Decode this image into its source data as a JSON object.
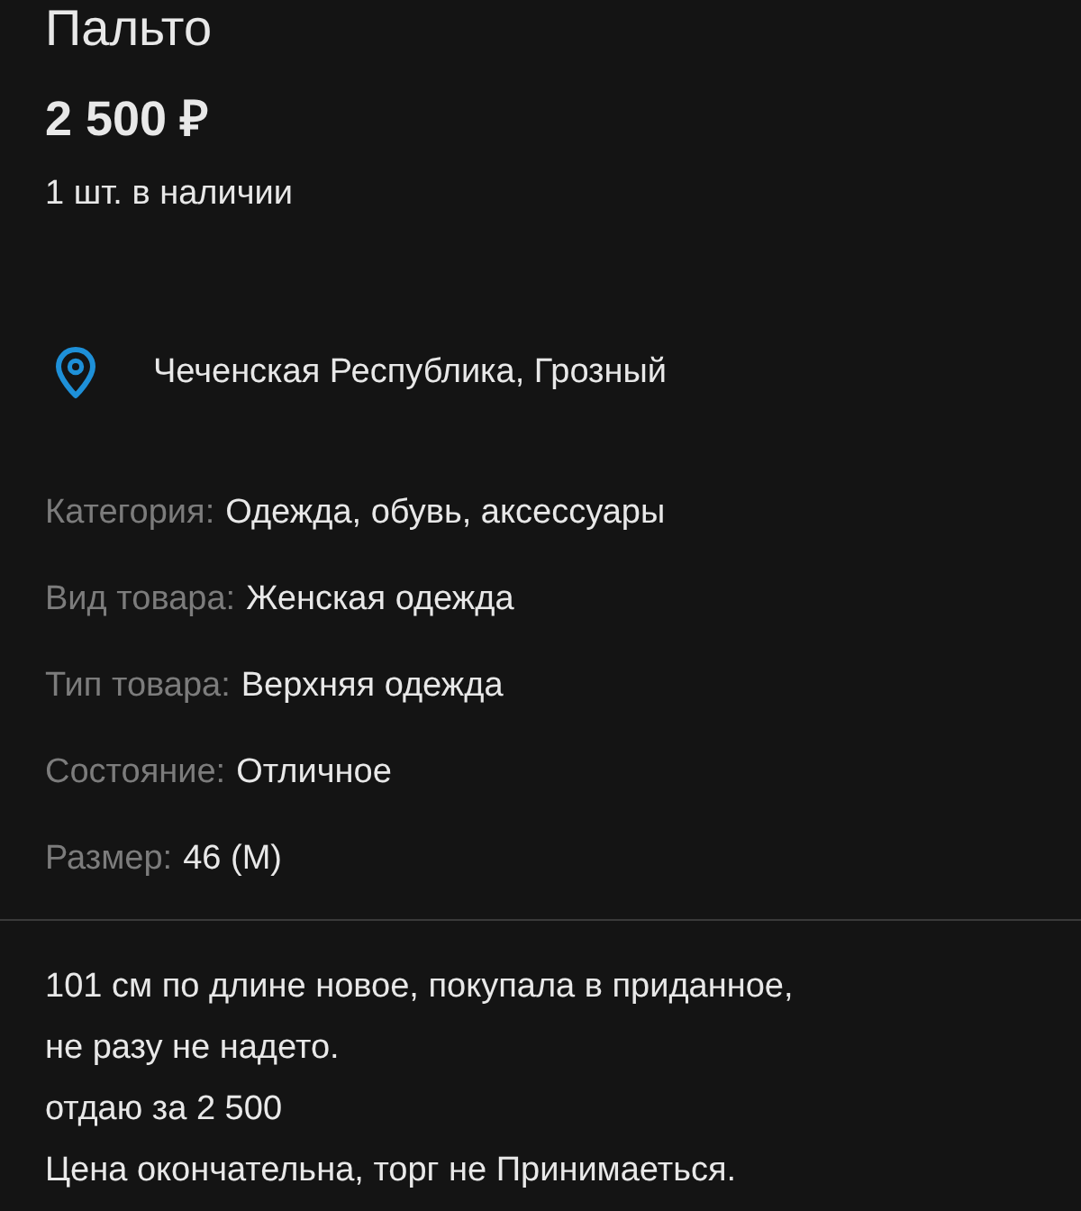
{
  "title": "Пальто",
  "price": "2 500 ₽",
  "stock": "1 шт. в наличии",
  "location": "Чеченская Республика, Грозный",
  "details": [
    {
      "label": "Категория:",
      "value": "Одежда, обувь, аксессуары"
    },
    {
      "label": "Вид товара:",
      "value": "Женская одежда"
    },
    {
      "label": "Тип товара:",
      "value": "Верхняя одежда"
    },
    {
      "label": "Состояние:",
      "value": "Отличное"
    },
    {
      "label": "Размер:",
      "value": "46 (M)"
    }
  ],
  "description": [
    "101 см по длине новое, покупала в приданное,",
    "не разу не надето.",
    "отдаю за 2 500",
    "Цена окончательна, торг не Принимаеться."
  ]
}
